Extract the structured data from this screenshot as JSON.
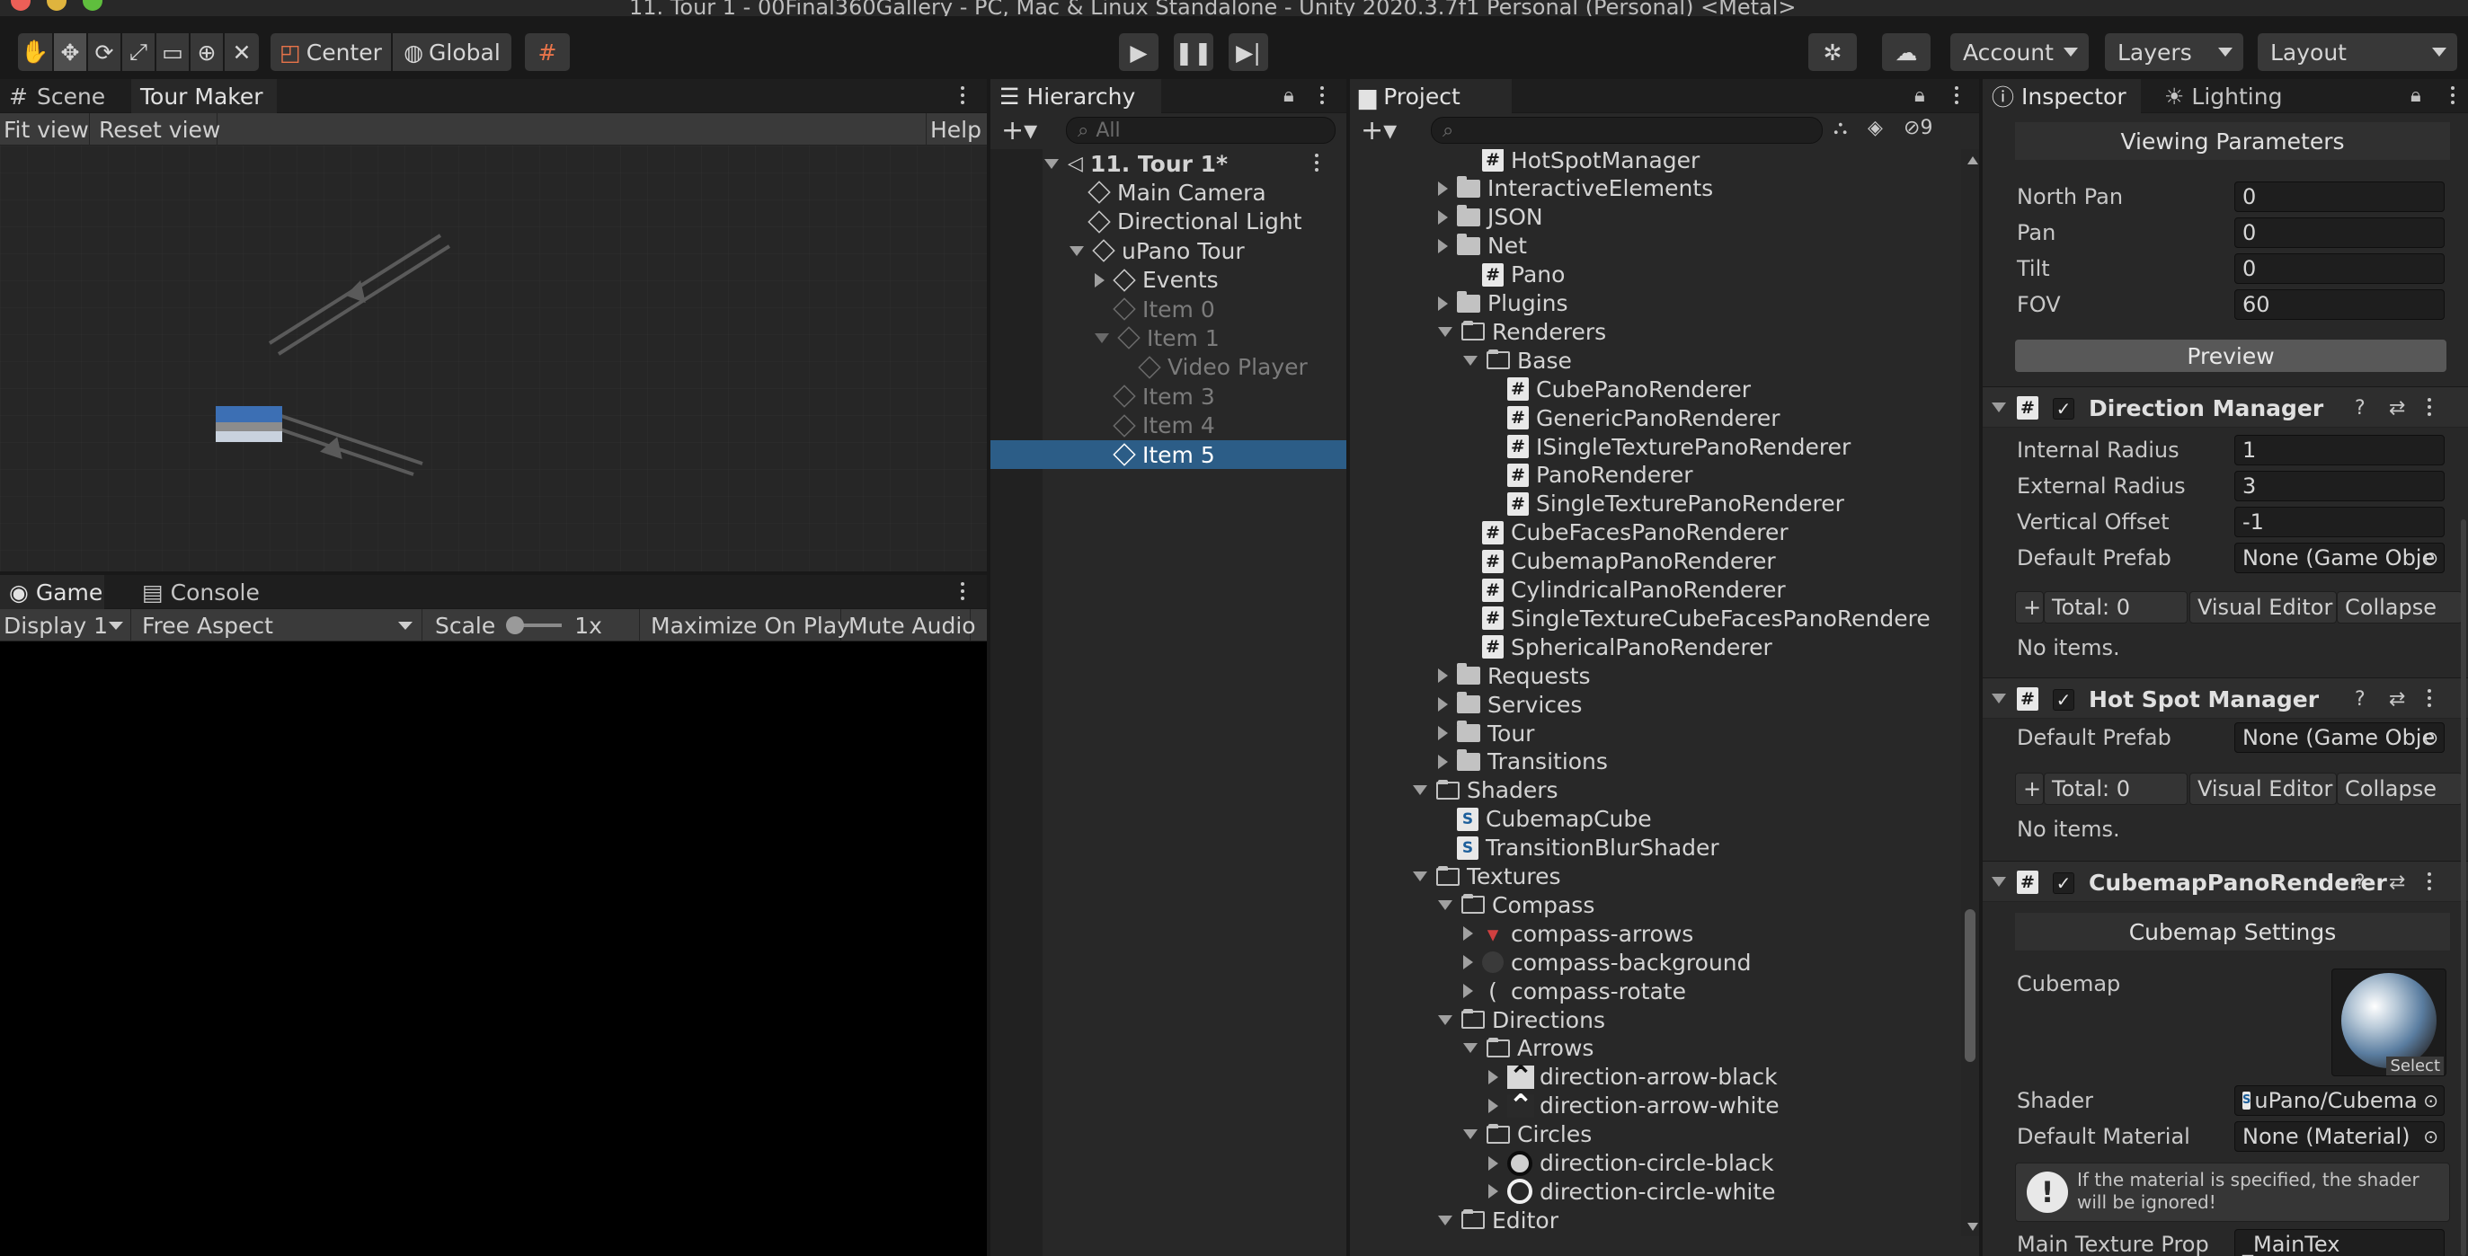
{
  "window": {
    "title": "11. Tour 1 - 00Final360Gallery - PC, Mac & Linux Standalone - Unity 2020.3.7f1 Personal (Personal) <Metal>"
  },
  "toolbar": {
    "center_label": "Center",
    "global_label": "Global",
    "account": "Account",
    "layers": "Layers",
    "layout": "Layout",
    "play_icon": "play-icon",
    "pause_icon": "pause-icon",
    "step_icon": "step-icon"
  },
  "scene_panel": {
    "tabs": [
      "Scene",
      "Tour Maker"
    ],
    "fit_view": "Fit view",
    "reset_view": "Reset view",
    "help": "Help"
  },
  "game_panel": {
    "tabs": [
      "Game",
      "Console"
    ],
    "display": "Display 1",
    "aspect": "Free Aspect",
    "scale_label": "Scale",
    "scale_value": "1x",
    "maximize": "Maximize On Play",
    "mute": "Mute Audio"
  },
  "hierarchy": {
    "tab": "Hierarchy",
    "search_placeholder": "All",
    "items": [
      {
        "label": "11. Tour 1*",
        "depth": 0,
        "state": "root"
      },
      {
        "label": "Main Camera",
        "depth": 1,
        "state": "normal"
      },
      {
        "label": "Directional Light",
        "depth": 1,
        "state": "normal"
      },
      {
        "label": "uPano Tour",
        "depth": 1,
        "state": "normal"
      },
      {
        "label": "Events",
        "depth": 2,
        "state": "normal"
      },
      {
        "label": "Item 0",
        "depth": 2,
        "state": "dim"
      },
      {
        "label": "Item 1",
        "depth": 2,
        "state": "dim"
      },
      {
        "label": "Video Player",
        "depth": 3,
        "state": "dim"
      },
      {
        "label": "Item 3",
        "depth": 2,
        "state": "dim"
      },
      {
        "label": "Item 4",
        "depth": 2,
        "state": "dim"
      },
      {
        "label": "Item 5",
        "depth": 2,
        "state": "selected"
      }
    ]
  },
  "project": {
    "tab": "Project",
    "hidden_count": "9",
    "items": [
      {
        "label": "HotSpotManager",
        "icon": "script",
        "indent": 5,
        "arrow": "none"
      },
      {
        "label": "InteractiveElements",
        "icon": "folder",
        "indent": 4,
        "arrow": "right"
      },
      {
        "label": "JSON",
        "icon": "folder",
        "indent": 4,
        "arrow": "right"
      },
      {
        "label": "Net",
        "icon": "folder",
        "indent": 4,
        "arrow": "right"
      },
      {
        "label": "Pano",
        "icon": "script",
        "indent": 5,
        "arrow": "none"
      },
      {
        "label": "Plugins",
        "icon": "folder",
        "indent": 4,
        "arrow": "right"
      },
      {
        "label": "Renderers",
        "icon": "folder-open",
        "indent": 4,
        "arrow": "down"
      },
      {
        "label": "Base",
        "icon": "folder-open",
        "indent": 5,
        "arrow": "down"
      },
      {
        "label": "CubePanoRenderer",
        "icon": "script",
        "indent": 6,
        "arrow": "none"
      },
      {
        "label": "GenericPanoRenderer",
        "icon": "script",
        "indent": 6,
        "arrow": "none"
      },
      {
        "label": "ISingleTexturePanoRenderer",
        "icon": "script",
        "indent": 6,
        "arrow": "none"
      },
      {
        "label": "PanoRenderer",
        "icon": "script",
        "indent": 6,
        "arrow": "none"
      },
      {
        "label": "SingleTexturePanoRenderer",
        "icon": "script",
        "indent": 6,
        "arrow": "none"
      },
      {
        "label": "CubeFacesPanoRenderer",
        "icon": "script",
        "indent": 5,
        "arrow": "none"
      },
      {
        "label": "CubemapPanoRenderer",
        "icon": "script",
        "indent": 5,
        "arrow": "none"
      },
      {
        "label": "CylindricalPanoRenderer",
        "icon": "script",
        "indent": 5,
        "arrow": "none"
      },
      {
        "label": "SingleTextureCubeFacesPanoRendere",
        "icon": "script",
        "indent": 5,
        "arrow": "none"
      },
      {
        "label": "SphericalPanoRenderer",
        "icon": "script",
        "indent": 5,
        "arrow": "none"
      },
      {
        "label": "Requests",
        "icon": "folder",
        "indent": 4,
        "arrow": "right"
      },
      {
        "label": "Services",
        "icon": "folder",
        "indent": 4,
        "arrow": "right"
      },
      {
        "label": "Tour",
        "icon": "folder",
        "indent": 4,
        "arrow": "right"
      },
      {
        "label": "Transitions",
        "icon": "folder",
        "indent": 4,
        "arrow": "right"
      },
      {
        "label": "Shaders",
        "icon": "folder-open",
        "indent": 3,
        "arrow": "down"
      },
      {
        "label": "CubemapCube",
        "icon": "shader",
        "indent": 4,
        "arrow": "none"
      },
      {
        "label": "TransitionBlurShader",
        "icon": "shader",
        "indent": 4,
        "arrow": "none"
      },
      {
        "label": "Textures",
        "icon": "folder-open",
        "indent": 3,
        "arrow": "down"
      },
      {
        "label": "Compass",
        "icon": "folder-open",
        "indent": 4,
        "arrow": "down"
      },
      {
        "label": "compass-arrows",
        "icon": "compass-arrows",
        "indent": 5,
        "arrow": "right"
      },
      {
        "label": "compass-background",
        "icon": "compass-background",
        "indent": 5,
        "arrow": "right"
      },
      {
        "label": "compass-rotate",
        "icon": "compass-rotate",
        "indent": 5,
        "arrow": "right"
      },
      {
        "label": "Directions",
        "icon": "folder-open",
        "indent": 4,
        "arrow": "down"
      },
      {
        "label": "Arrows",
        "icon": "folder-open",
        "indent": 5,
        "arrow": "down"
      },
      {
        "label": "direction-arrow-black",
        "icon": "arrow-black",
        "indent": 6,
        "arrow": "right"
      },
      {
        "label": "direction-arrow-white",
        "icon": "arrow-white",
        "indent": 6,
        "arrow": "right"
      },
      {
        "label": "Circles",
        "icon": "folder-open",
        "indent": 5,
        "arrow": "down"
      },
      {
        "label": "direction-circle-black",
        "icon": "circle-black",
        "indent": 6,
        "arrow": "right"
      },
      {
        "label": "direction-circle-white",
        "icon": "circle-white",
        "indent": 6,
        "arrow": "right"
      },
      {
        "label": "Editor",
        "icon": "folder-open",
        "indent": 4,
        "arrow": "down"
      }
    ]
  },
  "inspector": {
    "tabs": [
      "Inspector",
      "Lighting"
    ],
    "viewing": {
      "header": "Viewing Parameters",
      "fields": [
        {
          "label": "North Pan",
          "value": "0"
        },
        {
          "label": "Pan",
          "value": "0"
        },
        {
          "label": "Tilt",
          "value": "0"
        },
        {
          "label": "FOV",
          "value": "60"
        }
      ],
      "preview": "Preview"
    },
    "direction_manager": {
      "name": "Direction Manager",
      "fields": [
        {
          "label": "Internal Radius",
          "value": "1"
        },
        {
          "label": "External Radius",
          "value": "3"
        },
        {
          "label": "Vertical Offset",
          "value": "-1"
        },
        {
          "label": "Default Prefab",
          "value": "None (Game Obje"
        }
      ],
      "plus": "+",
      "total": "Total: 0",
      "visual_editor": "Visual Editor",
      "collapse": "Collapse",
      "no_items": "No items."
    },
    "hot_spot_manager": {
      "name": "Hot Spot Manager",
      "default_prefab_label": "Default Prefab",
      "default_prefab_value": "None (Game Obje",
      "plus": "+",
      "total": "Total: 0",
      "visual_editor": "Visual Editor",
      "collapse": "Collapse",
      "no_items": "No items."
    },
    "cubemap_renderer": {
      "name": "CubemapPanoRenderer",
      "settings_header": "Cubemap Settings",
      "cubemap_label": "Cubemap",
      "select": "Select",
      "shader_label": "Shader",
      "shader_value": "uPano/Cubema",
      "material_label": "Default Material",
      "material_value": "None (Material)",
      "warning": "If the material is specified, the shader will be ignored!",
      "main_tex_label": "Main Texture Prop",
      "main_tex_value": "_MainTex"
    }
  },
  "colors": {
    "selection": "#2c5d87",
    "panel": "#282828",
    "toolbar": "#191919"
  }
}
